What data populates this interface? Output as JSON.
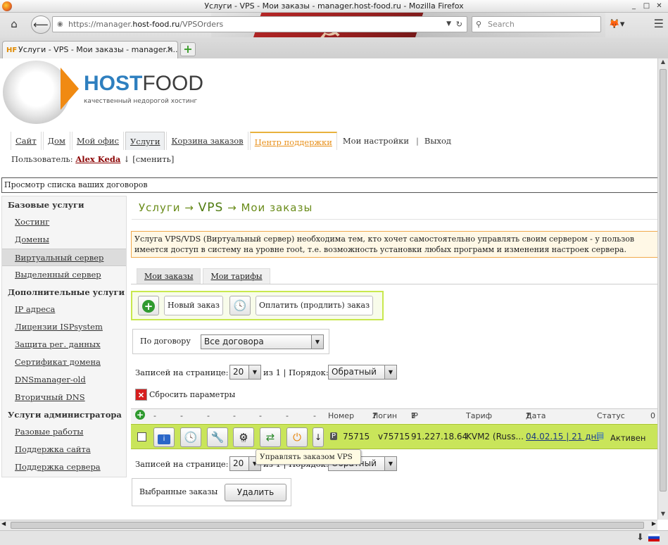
{
  "window": {
    "title": "Услуги - VPS - Мои заказы - manager.host-food.ru - Mozilla Firefox"
  },
  "browser": {
    "url_prefix": "https://manager.",
    "url_host": "host-food.ru",
    "url_path": "/VPSOrders",
    "search_placeholder": "Search",
    "tab_title": "Услуги - VPS - Мои заказы - manager.h...",
    "tab_favicon": "HF"
  },
  "logo": {
    "brand_blue": "HOST",
    "brand_grey": "FOOD",
    "tagline": "качественный недорогой хостинг"
  },
  "topnav": {
    "items": [
      "Сайт",
      "Дом",
      "Мой офис",
      "Услуги",
      "Корзина заказов",
      "Центр поддержки",
      "Мои настройки",
      "Выход"
    ],
    "separator": "|"
  },
  "user": {
    "label": "Пользователь:",
    "name": "Alex Keda",
    "arrow": "↓",
    "change": "[сменить]"
  },
  "breadcrumb": "Просмотр списка ваших договоров",
  "sidebar": {
    "sections": [
      {
        "title": "Базовые услуги",
        "items": [
          "Хостинг",
          "Домены",
          "Виртуальный сервер",
          "Выделенный сервер"
        ]
      },
      {
        "title": "Дополнительные услуги",
        "items": [
          "IP адреса",
          "Лицензии ISPsystem",
          "Защита рег. данных",
          "Сертификат домена",
          "DNSmanager-old",
          "Вторичный DNS"
        ]
      },
      {
        "title": "Услуги администратора",
        "items": [
          "Разовые работы",
          "Поддержка сайта",
          "Поддержка сервера"
        ]
      }
    ]
  },
  "page": {
    "title_a": "Услуги",
    "arrow": "→",
    "title_b": "VPS",
    "title_c": "Мои заказы",
    "info_line1": "Услуга VPS/VDS (Виртуальный сервер) необходима тем, кто хочет самостоятельно управлять своим сервером - у пользов",
    "info_line2": "имеется доступ в систему на уровне root, т.е. возможность установки любых программ и изменения настроек сервера."
  },
  "subtabs": [
    "Мои заказы",
    "Мои тарифы"
  ],
  "actions": {
    "new_order": "Новый заказ",
    "pay": "Оплатить (продлить) заказ"
  },
  "filter": {
    "label": "По договору",
    "value": "Все договора"
  },
  "pager": {
    "label": "Записей на странице:",
    "per_page": "20",
    "of": "из 1 | Порядок:",
    "order": "Обратный"
  },
  "reset": "Сбросить параметры",
  "table": {
    "dashes": [
      "-",
      "-",
      "-",
      "-",
      "-",
      "-",
      "-",
      "-",
      "-",
      "-",
      "-"
    ],
    "headers": {
      "number": "Номер",
      "login": "Логин",
      "ip": "IP",
      "tariff": "Тариф",
      "date": "Дата оконч.",
      "status": "Статус",
      "extra": "0",
      "q": "?"
    },
    "row": {
      "number": "75715",
      "login": "v75715",
      "ip": "91.227.18.64",
      "tariff": "KVM2 (Russ...",
      "date": "04.02.15 | 21 дн.",
      "status": "Активен"
    }
  },
  "tooltip": "Управлять заказом VPS",
  "bulk": {
    "label": "Выбранные заказы",
    "delete": "Удалить"
  }
}
